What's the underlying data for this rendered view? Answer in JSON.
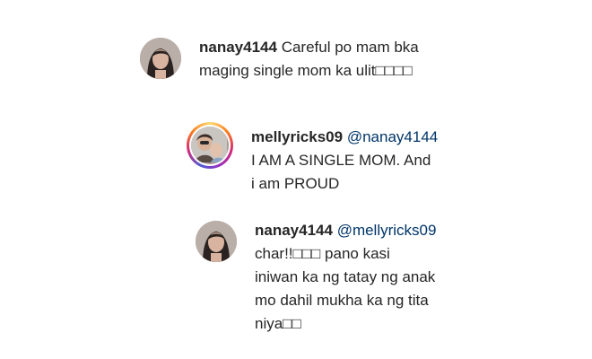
{
  "comments": [
    {
      "username": "nanay4144",
      "mention": "",
      "lines": [
        "Careful po mam bka",
        "maging single mom ka ulit□□□□"
      ]
    },
    {
      "username": "mellyricks09",
      "mention": "@nanay4144",
      "lines": [
        "I AM A SINGLE MOM. And",
        "i am PROUD"
      ]
    },
    {
      "username": "nanay4144",
      "mention": "@mellyricks09",
      "lines": [
        "char!!□□□ pano kasi",
        "iniwan ka ng tatay ng anak",
        "mo dahil mukha ka ng tita",
        "niya□□"
      ]
    }
  ],
  "icons": {
    "avatar_nanay": "profile-photo-icon",
    "avatar_melly": "profile-photo-icon"
  },
  "colors": {
    "username": "#262626",
    "mention": "#003569",
    "story_ring": "#d62976"
  }
}
